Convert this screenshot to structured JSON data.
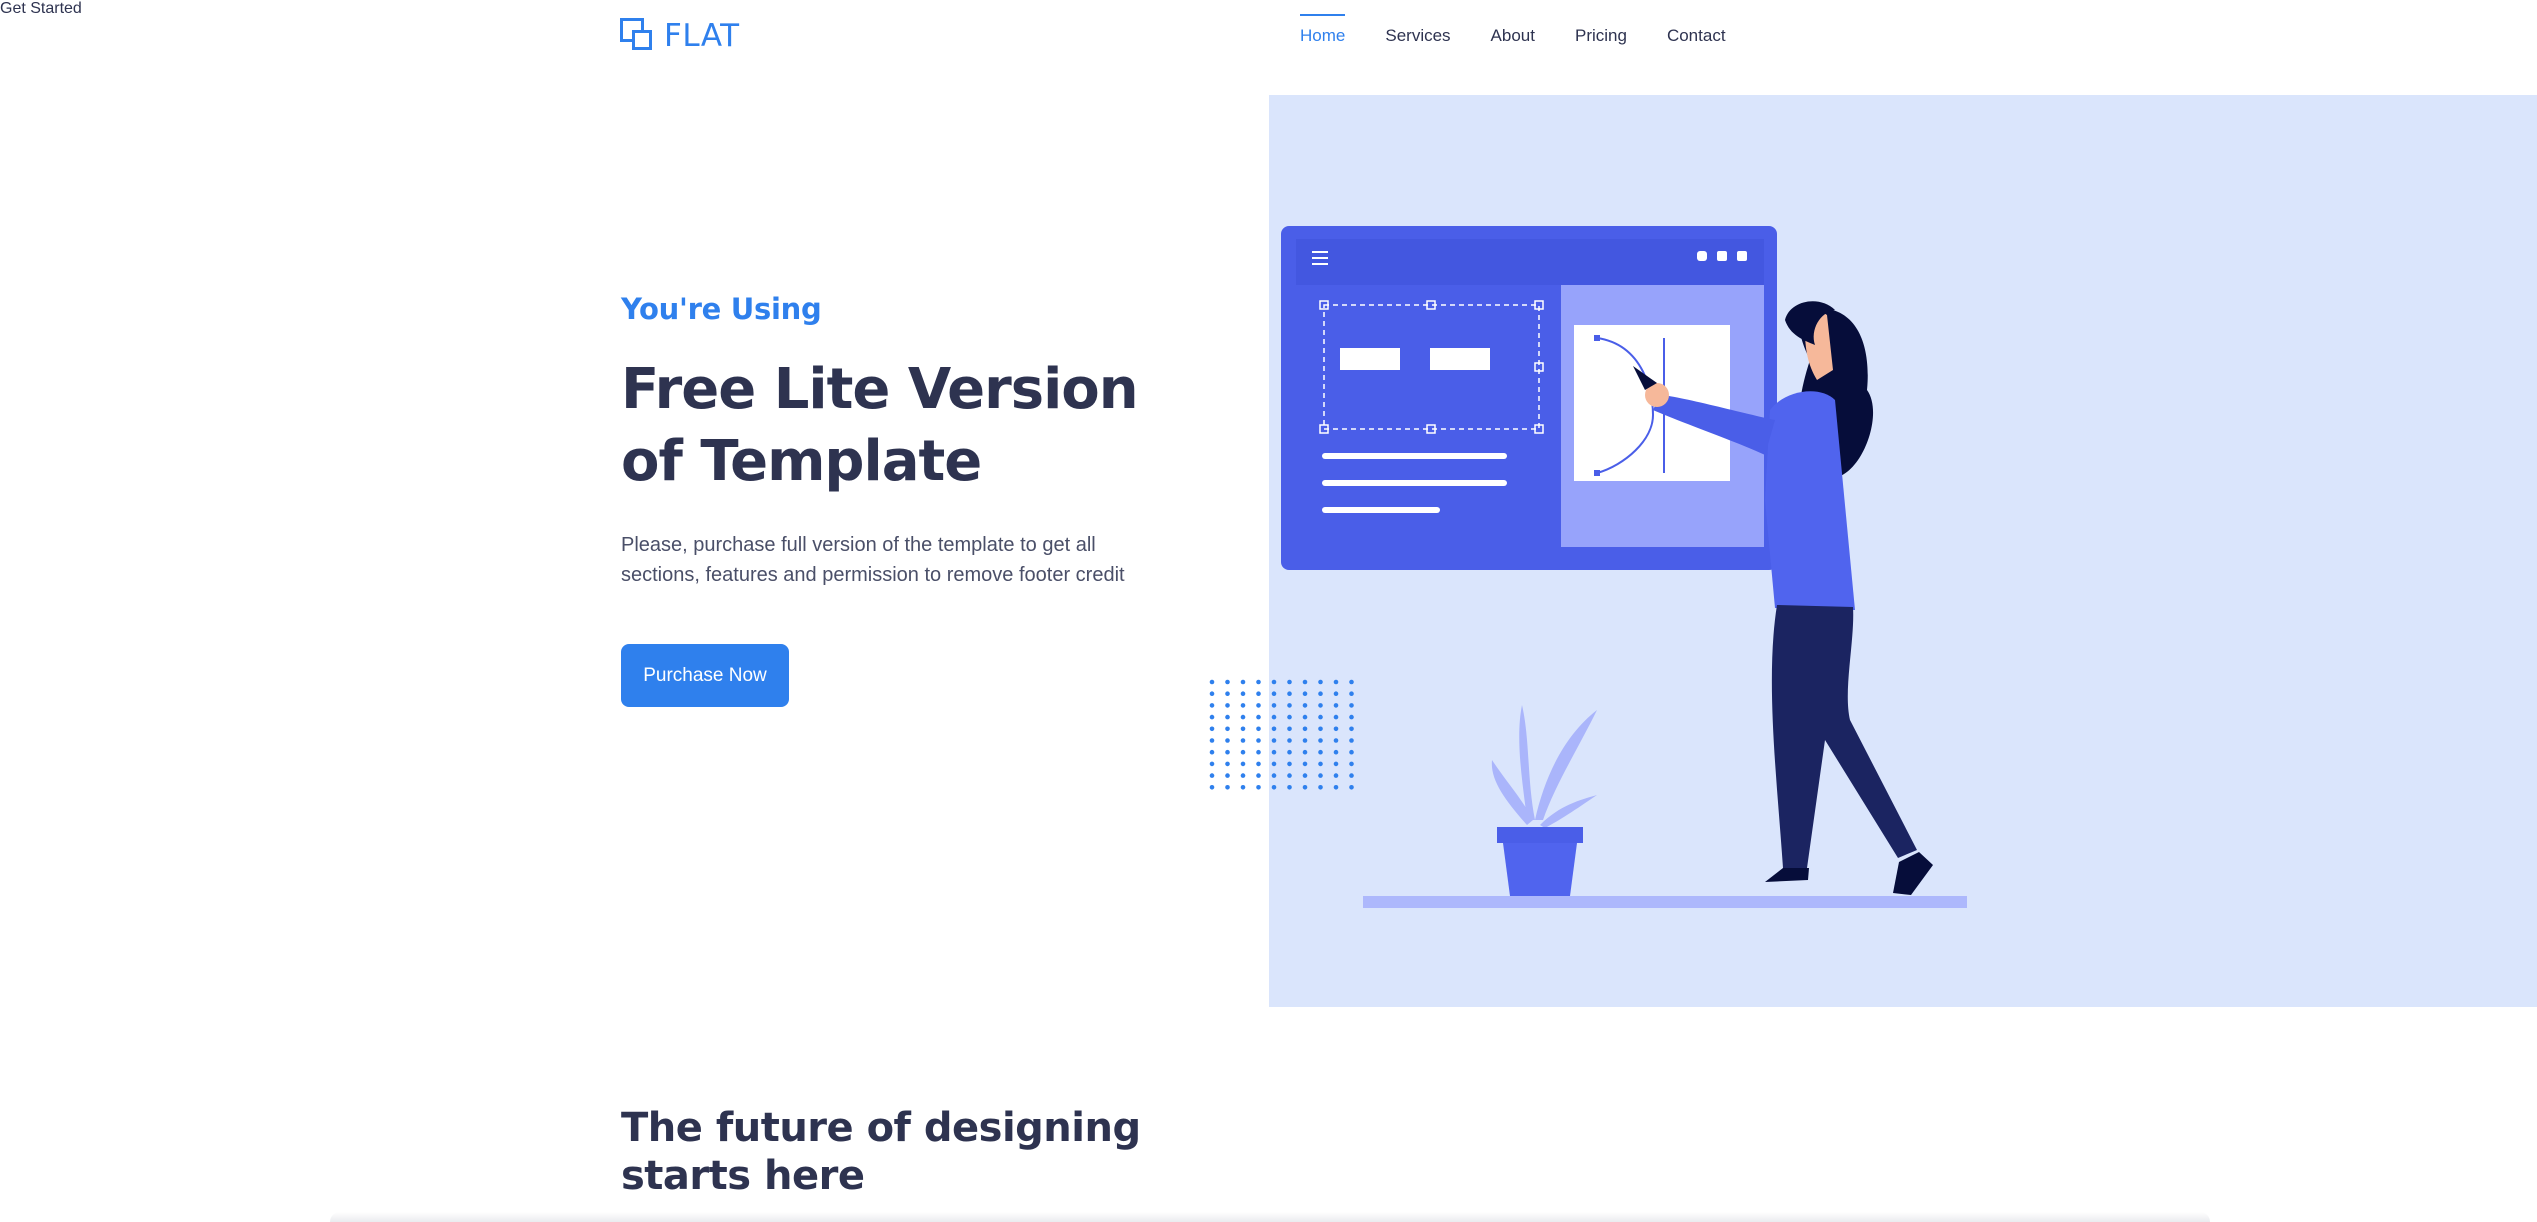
{
  "header": {
    "logo_text": "FLAT",
    "nav": [
      {
        "label": "Home",
        "active": true
      },
      {
        "label": "Services",
        "active": false
      },
      {
        "label": "About",
        "active": false
      },
      {
        "label": "Pricing",
        "active": false
      },
      {
        "label": "Contact",
        "active": false
      }
    ],
    "cta_label": "Get Started"
  },
  "hero": {
    "kicker": "You're Using",
    "title": "Free Lite Version of Template",
    "description": "Please, purchase full version of the template to get all sections, features and permission to remove footer credit",
    "button_label": "Purchase Now"
  },
  "section2": {
    "title": "The future of designing starts here"
  },
  "colors": {
    "accent": "#2f80ed",
    "heading": "#2e3350",
    "hero_bg": "#dae5fc",
    "illustration_primary": "#4a5ee8",
    "illustration_dark": "#1b2461"
  }
}
